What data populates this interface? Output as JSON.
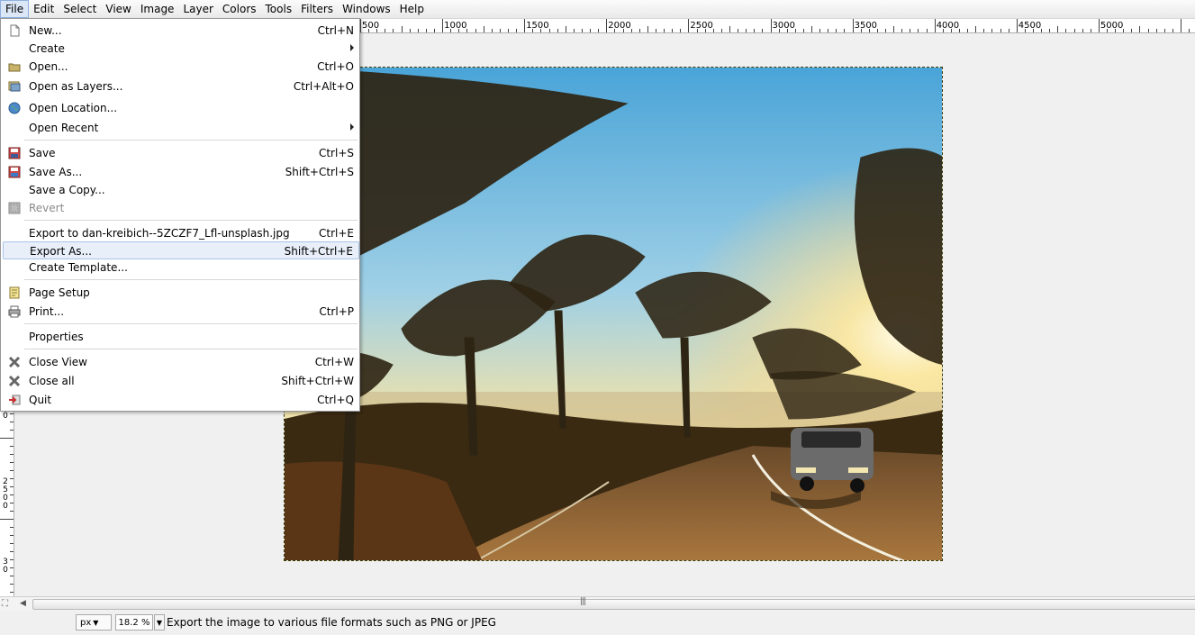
{
  "menubar": {
    "items": [
      "File",
      "Edit",
      "Select",
      "View",
      "Image",
      "Layer",
      "Colors",
      "Tools",
      "Filters",
      "Windows",
      "Help"
    ]
  },
  "ruler": {
    "h_labels": [
      "500",
      "1000",
      "1500",
      "2000",
      "2500",
      "3000",
      "3500",
      "4000",
      "4500",
      "5000"
    ],
    "v_labels": [
      [
        "0"
      ],
      [
        "2",
        "5",
        "0",
        "0"
      ],
      [
        "3",
        "0"
      ]
    ]
  },
  "file_menu": {
    "items": [
      {
        "label": "New...",
        "accel": "Ctrl+N",
        "icon": "new-document-icon"
      },
      {
        "label": "Create",
        "accel": "",
        "icon": "",
        "submenu": true
      },
      {
        "label": "Open...",
        "accel": "Ctrl+O",
        "icon": "open-folder-icon"
      },
      {
        "label": "Open as Layers...",
        "accel": "Ctrl+Alt+O",
        "icon": "open-layers-icon"
      },
      {
        "label": "Open Location...",
        "accel": "",
        "icon": "globe-icon"
      },
      {
        "label": "Open Recent",
        "accel": "",
        "icon": "",
        "submenu": true
      },
      {
        "label": "Save",
        "accel": "Ctrl+S",
        "icon": "save-icon"
      },
      {
        "label": "Save As...",
        "accel": "Shift+Ctrl+S",
        "icon": "save-as-icon"
      },
      {
        "label": "Save a Copy...",
        "accel": "",
        "icon": ""
      },
      {
        "label": "Revert",
        "accel": "",
        "icon": "revert-icon",
        "disabled": true
      },
      {
        "label": "Export to dan-kreibich--5ZCZF7_Lfl-unsplash.jpg",
        "accel": "Ctrl+E",
        "icon": ""
      },
      {
        "label": "Export As...",
        "accel": "Shift+Ctrl+E",
        "icon": "",
        "highlighted": true
      },
      {
        "label": "Create Template...",
        "accel": "",
        "icon": ""
      },
      {
        "label": "Page Setup",
        "accel": "",
        "icon": "page-setup-icon"
      },
      {
        "label": "Print...",
        "accel": "Ctrl+P",
        "icon": "printer-icon"
      },
      {
        "label": "Properties",
        "accel": "",
        "icon": ""
      },
      {
        "label": "Close View",
        "accel": "Ctrl+W",
        "icon": "close-icon"
      },
      {
        "label": "Close all",
        "accel": "Shift+Ctrl+W",
        "icon": "close-icon"
      },
      {
        "label": "Quit",
        "accel": "Ctrl+Q",
        "icon": "quit-icon"
      }
    ]
  },
  "statusbar": {
    "unit": "px",
    "zoom": "18.2 %",
    "message": "Export the image to various file formats such as PNG or JPEG"
  },
  "colors": {
    "menu_highlight": "#e8eff9",
    "selection_border": "#3a3a00"
  }
}
